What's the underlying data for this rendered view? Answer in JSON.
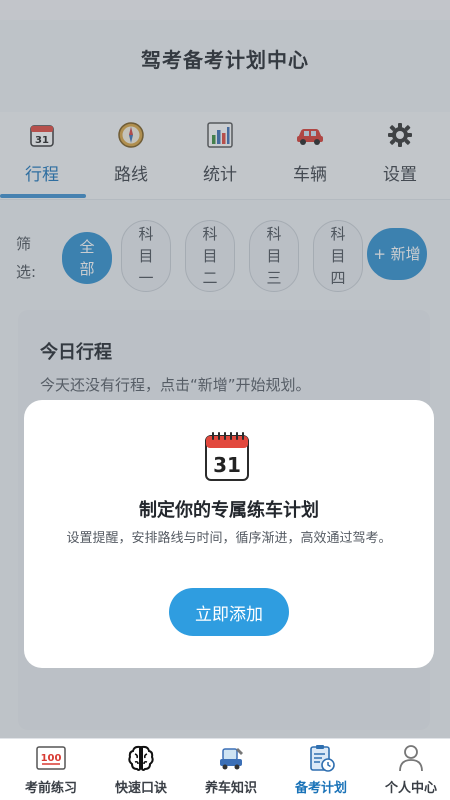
{
  "header": {
    "title": "驾考备考计划中心"
  },
  "tabs": [
    {
      "label": "行程",
      "icon": "calendar-icon",
      "active": true
    },
    {
      "label": "路线",
      "icon": "compass-icon",
      "active": false
    },
    {
      "label": "统计",
      "icon": "bar-chart-icon",
      "active": false
    },
    {
      "label": "车辆",
      "icon": "car-icon",
      "active": false
    },
    {
      "label": "设置",
      "icon": "gear-icon",
      "active": false
    }
  ],
  "filter": {
    "label": "筛选:",
    "chips": [
      "全部",
      "科目一",
      "科目二",
      "科目三",
      "科目四"
    ],
    "active_chip": "全部",
    "new_button": "+ 新增"
  },
  "today_card": {
    "title": "今日行程",
    "text": "今天还没有行程，点击“新增”开始规划。"
  },
  "modal": {
    "icon": "calendar-icon",
    "title": "制定你的专属练车计划",
    "description": "设置提醒，安排路线与时间，循序渐进，高效通过驾考。",
    "button": "立即添加"
  },
  "bottom_nav": [
    {
      "label": "考前练习",
      "icon": "score-100-icon",
      "active": false
    },
    {
      "label": "快速口诀",
      "icon": "brain-icon",
      "active": false
    },
    {
      "label": "养车知识",
      "icon": "car-repair-icon",
      "active": false
    },
    {
      "label": "备考计划",
      "icon": "clipboard-clock-icon",
      "active": true
    },
    {
      "label": "个人中心",
      "icon": "person-icon",
      "active": false
    }
  ],
  "colors": {
    "accent": "#2f8fcf",
    "button": "#2f9de0",
    "active_text": "#1a73b8"
  }
}
